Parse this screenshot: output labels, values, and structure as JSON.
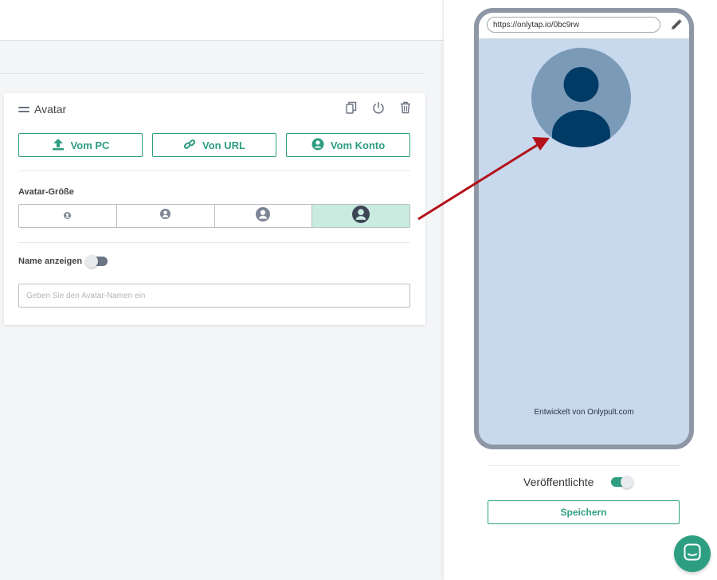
{
  "card": {
    "title": "Avatar",
    "buttons": {
      "from_pc": "Vom PC",
      "from_url": "Von URL",
      "from_account": "Vom Konto"
    },
    "size_label": "Avatar-Größe",
    "size_options": [
      "size-xs",
      "size-s",
      "size-m",
      "size-l"
    ],
    "selected_size_index": 3,
    "show_name_label": "Name anzeigen",
    "show_name_enabled": false,
    "name_input": {
      "value": "",
      "placeholder": "Geben Sie den Avatar-Namen ein"
    }
  },
  "preview": {
    "url": "https://onlytap.io/0bc9rw",
    "footer": "Entwickelt von Onlypult.com",
    "publish_label": "Veröffentlichte",
    "publish_enabled": true,
    "save_label": "Speichern"
  },
  "colors": {
    "accent": "#2e9e82",
    "accent_light": "#c9ebe0",
    "phone_bg": "#c8d8ed",
    "avatar_bg": "#7a9ab8",
    "avatar_fg": "#003b66",
    "annotation_arrow": "#b3121a"
  },
  "icons": [
    "drag-icon",
    "copy-icon",
    "power-icon",
    "trash-icon",
    "upload-icon",
    "link-icon",
    "account-icon",
    "user-icon",
    "pencil-icon",
    "chat-icon"
  ]
}
